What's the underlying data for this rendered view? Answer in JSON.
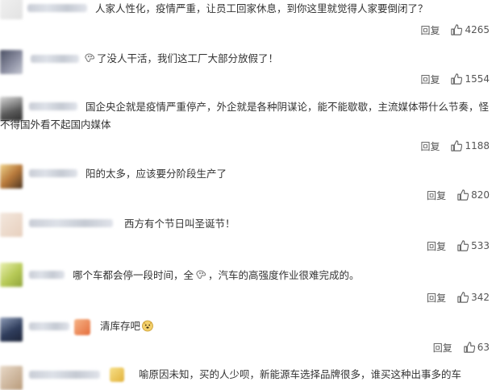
{
  "comments": [
    {
      "text": "人家人性化，疫情严重，让员工回家休息，到你这里就觉得人家要倒闭了？",
      "reply_label": "回复",
      "likes": "4265"
    },
    {
      "text_after_emoji": "了没人干活，我们这工厂大部分放假了！",
      "reply_label": "回复",
      "likes": "1554"
    },
    {
      "text": "国企央企就是疫情严重停产，外企就是各种阴谋论，能不能歇歇，主流媒体带什么节奏，怪不得国外看不起国内媒体",
      "reply_label": "回复",
      "likes": "1188"
    },
    {
      "text": "阳的太多，应该要分阶段生产了",
      "reply_label": "回复",
      "likes": "820"
    },
    {
      "text": "西方有个节日叫圣诞节！",
      "reply_label": "回复",
      "likes": "533"
    },
    {
      "text_before_emoji": "哪个车都会停一段时间，全",
      "text_after_emoji": "，汽车的高强度作业很难完成的。",
      "reply_label": "回复",
      "likes": "342"
    },
    {
      "text": "清库存吧",
      "reply_label": "回复",
      "likes": "63"
    },
    {
      "text": "喻原因未知，买的人少呗，新能源车选择品牌很多，谁买这种出事多的车"
    }
  ],
  "icons": {
    "like": "thumbs-up-icon",
    "emoji_sick": "sick-face-emoji-icon",
    "emoji_doge": "doge-emoji-icon"
  },
  "colors": {
    "text": "#333333",
    "action": "#555555",
    "divider": "#eeeeee"
  }
}
